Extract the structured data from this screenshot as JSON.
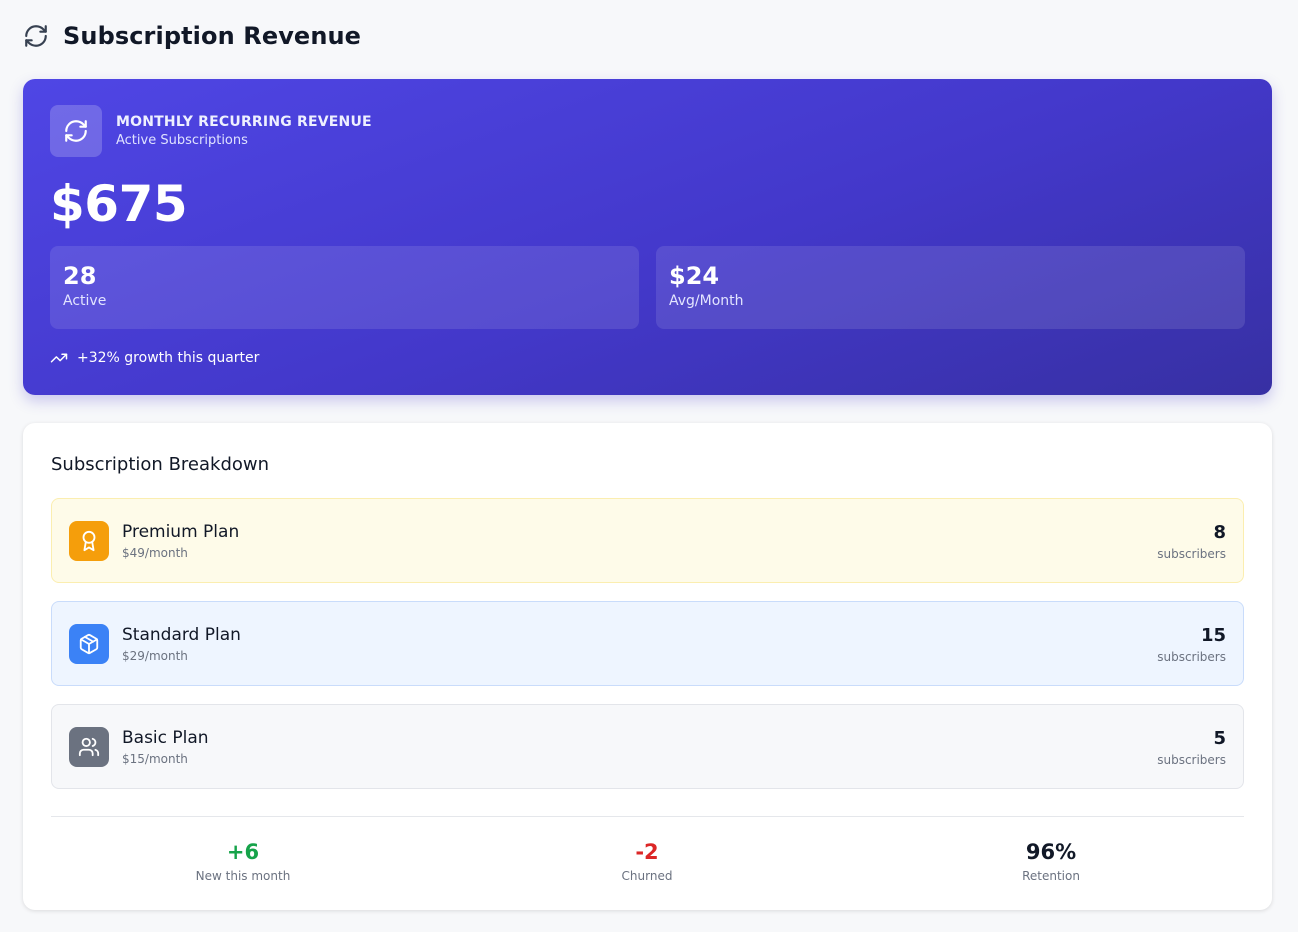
{
  "header": {
    "title": "Subscription Revenue",
    "icon": "refresh-icon"
  },
  "hero": {
    "icon": "refresh-icon",
    "title": "MONTHLY RECURRING REVENUE",
    "subtitle": "Active Subscriptions",
    "amount": "$675",
    "stats": [
      {
        "value": "28",
        "label": "Active"
      },
      {
        "value": "$24",
        "label": "Avg/Month"
      }
    ],
    "growth": {
      "icon": "trending-up-icon",
      "text": "+32% growth this quarter"
    },
    "colors": {
      "gradient_start": "#4f46e5",
      "gradient_end": "#3730a3"
    }
  },
  "breakdown": {
    "title": "Subscription Breakdown",
    "plans": [
      {
        "name": "Premium Plan",
        "price": "$49/month",
        "count": "8",
        "count_label": "subscribers",
        "icon": "award-icon",
        "color": "#f59e0b"
      },
      {
        "name": "Standard Plan",
        "price": "$29/month",
        "count": "15",
        "count_label": "subscribers",
        "icon": "package-icon",
        "color": "#3b82f6"
      },
      {
        "name": "Basic Plan",
        "price": "$15/month",
        "count": "5",
        "count_label": "subscribers",
        "icon": "users-icon",
        "color": "#6b7280"
      }
    ],
    "summary": [
      {
        "value": "+6",
        "label": "New this month",
        "color": "#16a34a"
      },
      {
        "value": "-2",
        "label": "Churned",
        "color": "#dc2626"
      },
      {
        "value": "96%",
        "label": "Retention",
        "color": "#111827"
      }
    ]
  }
}
